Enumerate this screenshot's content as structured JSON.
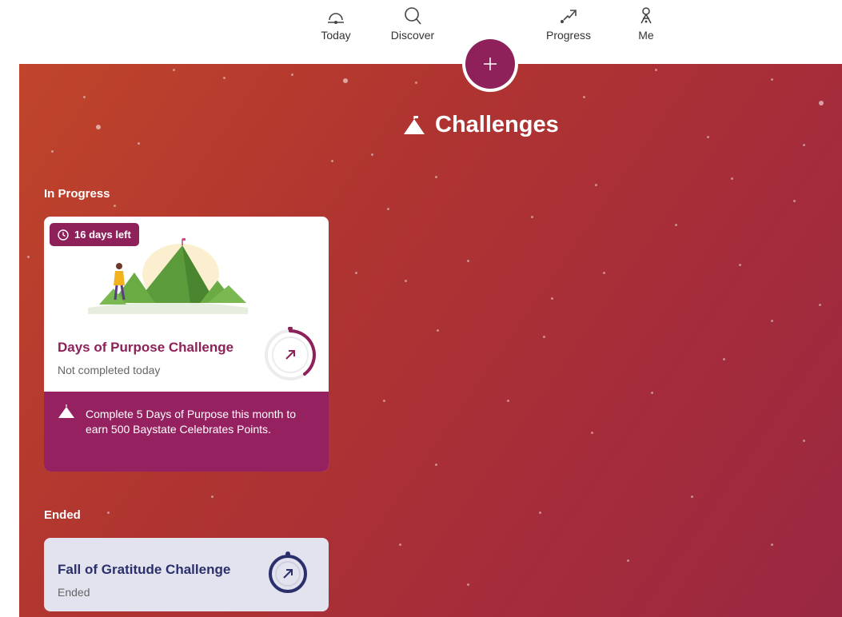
{
  "nav": {
    "items": [
      {
        "label": "Today",
        "icon": "sunrise-icon"
      },
      {
        "label": "Discover",
        "icon": "search-icon"
      },
      {
        "label": "Progress",
        "icon": "trend-arrow-icon"
      },
      {
        "label": "Me",
        "icon": "person-icon"
      }
    ],
    "add_icon": "plus-icon"
  },
  "page": {
    "title": "Challenges"
  },
  "sections": {
    "in_progress": {
      "label": "In Progress",
      "card": {
        "badge": "16 days left",
        "title": "Days of Purpose Challenge",
        "status": "Not completed today",
        "description": "Complete 5 Days of Purpose this month to earn 500 Baystate Celebrates Points."
      }
    },
    "ended": {
      "label": "Ended",
      "card": {
        "title": "Fall of Gratitude Challenge",
        "status": "Ended"
      }
    }
  },
  "colors": {
    "accent": "#8e2159",
    "ended_title": "#2b2f6b",
    "hero_start": "#c0452b",
    "hero_end": "#9a2842"
  }
}
